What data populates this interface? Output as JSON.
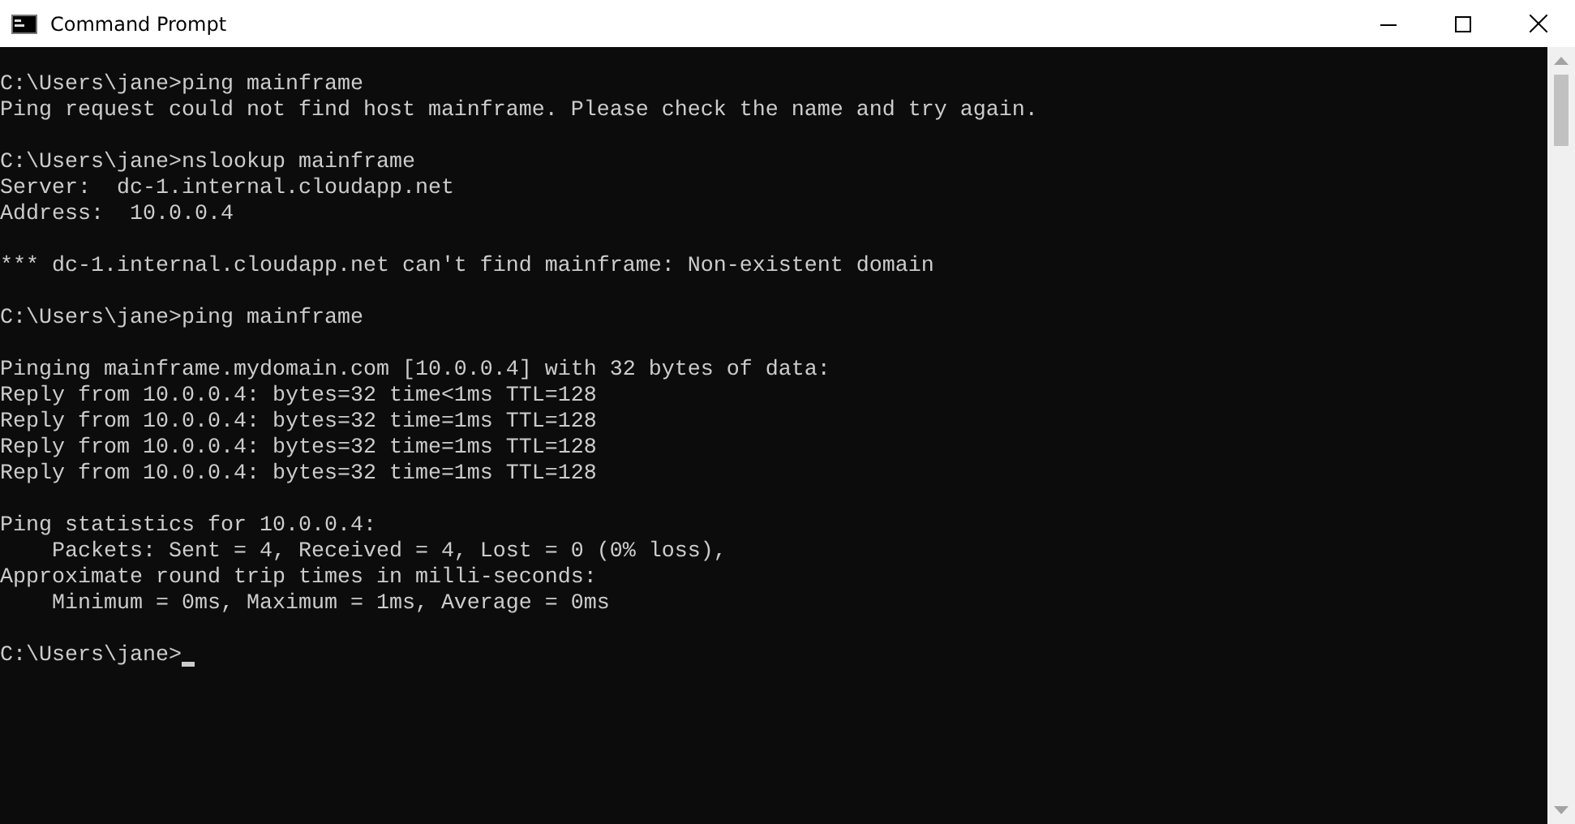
{
  "window": {
    "title": "Command Prompt"
  },
  "console": {
    "blocks": [
      [
        "C:\\Users\\jane>ping mainframe",
        "Ping request could not find host mainframe. Please check the name and try again."
      ],
      [
        "C:\\Users\\jane>nslookup mainframe",
        "Server:  dc-1.internal.cloudapp.net",
        "Address:  10.0.0.4"
      ],
      [
        "*** dc-1.internal.cloudapp.net can't find mainframe: Non-existent domain"
      ],
      [
        "C:\\Users\\jane>ping mainframe"
      ],
      [
        "Pinging mainframe.mydomain.com [10.0.0.4] with 32 bytes of data:",
        "Reply from 10.0.0.4: bytes=32 time<1ms TTL=128",
        "Reply from 10.0.0.4: bytes=32 time=1ms TTL=128",
        "Reply from 10.0.0.4: bytes=32 time=1ms TTL=128",
        "Reply from 10.0.0.4: bytes=32 time=1ms TTL=128"
      ],
      [
        "Ping statistics for 10.0.0.4:",
        "    Packets: Sent = 4, Received = 4, Lost = 0 (0% loss),",
        "Approximate round trip times in milli-seconds:",
        "    Minimum = 0ms, Maximum = 1ms, Average = 0ms"
      ]
    ],
    "prompt": "C:\\Users\\jane>"
  }
}
